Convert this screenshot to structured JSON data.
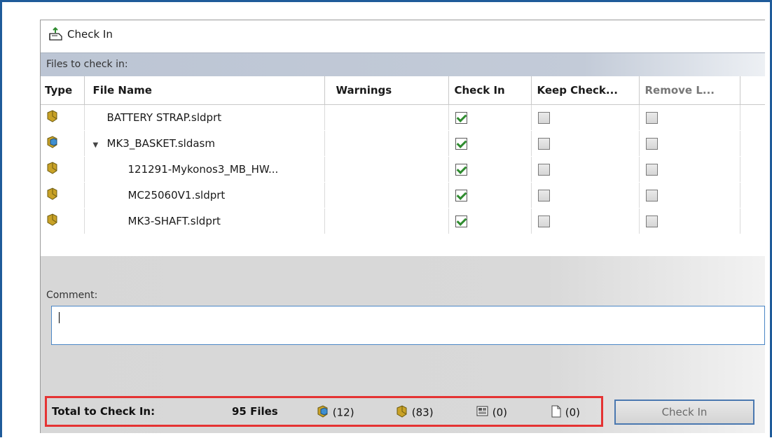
{
  "dialog": {
    "title": "Check In"
  },
  "files_section": {
    "label": "Files to check in:"
  },
  "columns": [
    "Type",
    "File Name",
    "Warnings",
    "Check In",
    "Keep Check...",
    "Remove L..."
  ],
  "rows": [
    {
      "type": "part",
      "name": "BATTERY STRAP.sldprt",
      "level": 0,
      "expandable": false,
      "warnings": "",
      "check_in": true,
      "keep_checked_out": false,
      "remove_local": false
    },
    {
      "type": "assembly",
      "name": "MK3_BASKET.sldasm",
      "level": 0,
      "expandable": true,
      "warnings": "",
      "check_in": true,
      "keep_checked_out": false,
      "remove_local": false
    },
    {
      "type": "part",
      "name": "121291-Mykonos3_MB_HW...",
      "level": 1,
      "expandable": false,
      "warnings": "",
      "check_in": true,
      "keep_checked_out": false,
      "remove_local": false
    },
    {
      "type": "part",
      "name": "MC25060V1.sldprt",
      "level": 1,
      "expandable": false,
      "warnings": "",
      "check_in": true,
      "keep_checked_out": false,
      "remove_local": false
    },
    {
      "type": "part",
      "name": "MK3-SHAFT.sldprt",
      "level": 1,
      "expandable": false,
      "warnings": "",
      "check_in": true,
      "keep_checked_out": false,
      "remove_local": false
    }
  ],
  "comment": {
    "label": "Comment:",
    "value": ""
  },
  "summary": {
    "label": "Total to Check In:",
    "files": "95 Files",
    "assemblies": "(12)",
    "parts": "(83)",
    "drawings": "(0)",
    "other": "(0)"
  },
  "buttons": {
    "check_in": "Check In"
  },
  "colors": {
    "frame": "#1f5b9a",
    "highlight": "#e53333",
    "check": "#2e8b2e",
    "assembly_icon": "#3f8fd0",
    "part_icon": "#c9a227"
  }
}
